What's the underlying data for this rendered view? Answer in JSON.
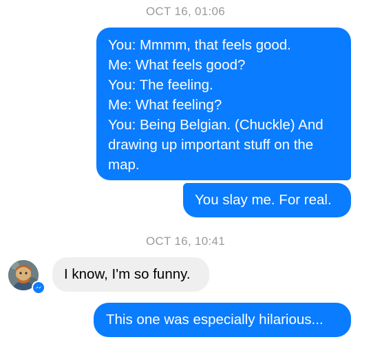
{
  "conversation": {
    "timestamp_1": "OCT 16, 01:06",
    "timestamp_2": "OCT 16, 10:41",
    "messages": [
      {
        "sender": "me",
        "lines": [
          "You: Mmmm, that feels good.",
          "Me: What feels good?",
          "You: The feeling.",
          "Me: What feeling?",
          "You: Being Belgian. (Chuckle) And",
          "drawing up important stuff on the",
          "map."
        ]
      },
      {
        "sender": "me",
        "text": "You slay me. For real."
      },
      {
        "sender": "other",
        "text": "I know, I'm so funny."
      },
      {
        "sender": "me",
        "text": "This one was especially hilarious..."
      }
    ]
  },
  "icons": {
    "avatar": "avatar-icon",
    "badge": "messenger-badge-icon"
  },
  "colors": {
    "outgoing_bubble": "#0a7cff",
    "incoming_bubble": "#efefef",
    "timestamp_text": "#9a9a9e"
  }
}
